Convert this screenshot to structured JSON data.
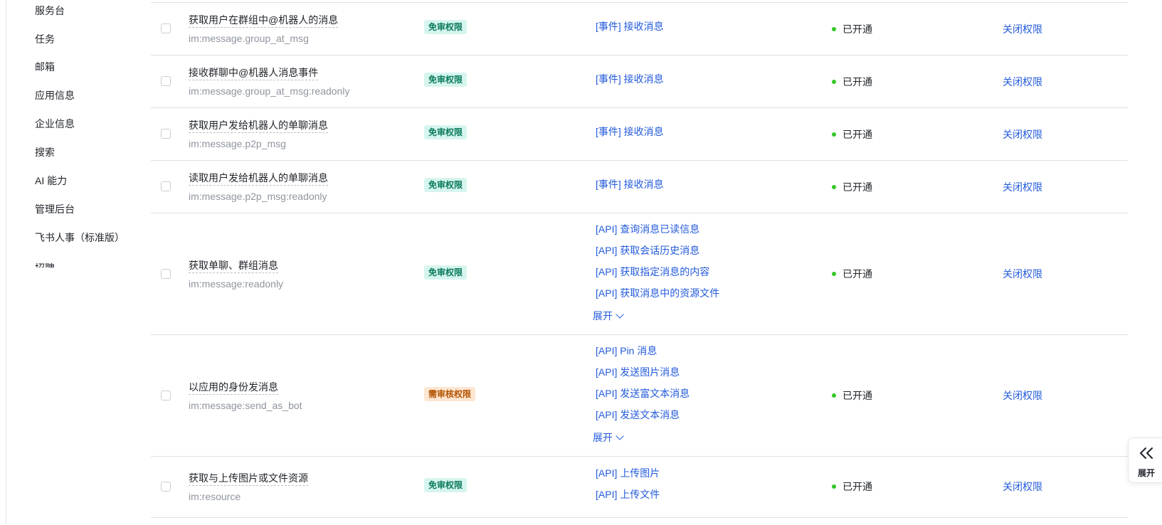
{
  "sidebar": {
    "items": [
      {
        "label": "服务台"
      },
      {
        "label": "任务"
      },
      {
        "label": "邮箱"
      },
      {
        "label": "应用信息"
      },
      {
        "label": "企业信息"
      },
      {
        "label": "搜索"
      },
      {
        "label": "AI 能力"
      },
      {
        "label": "管理后台"
      },
      {
        "label": "飞书人事（标准版）"
      },
      {
        "label": "招聘"
      }
    ]
  },
  "rows": [
    {
      "name": "获取用户在群组中@机器人的消息",
      "code": "im:message.group_at_msg",
      "tag": "免审权限",
      "apis": [
        "[事件] 接收消息"
      ],
      "expand": "",
      "status": "已开通",
      "action": "关闭权限"
    },
    {
      "name": "接收群聊中@机器人消息事件",
      "code": "im:message.group_at_msg:readonly",
      "tag": "免审权限",
      "apis": [
        "[事件] 接收消息"
      ],
      "expand": "",
      "status": "已开通",
      "action": "关闭权限"
    },
    {
      "name": "获取用户发给机器人的单聊消息",
      "code": "im:message.p2p_msg",
      "tag": "免审权限",
      "apis": [
        "[事件] 接收消息"
      ],
      "expand": "",
      "status": "已开通",
      "action": "关闭权限"
    },
    {
      "name": "读取用户发给机器人的单聊消息",
      "code": "im:message.p2p_msg:readonly",
      "tag": "免审权限",
      "apis": [
        "[事件] 接收消息"
      ],
      "expand": "",
      "status": "已开通",
      "action": "关闭权限"
    },
    {
      "name": "获取单聊、群组消息",
      "code": "im:message:readonly",
      "tag": "免审权限",
      "apis": [
        "[API] 查询消息已读信息",
        "[API] 获取会话历史消息",
        "[API] 获取指定消息的内容",
        "[API] 获取消息中的资源文件"
      ],
      "expand": "展开",
      "status": "已开通",
      "action": "关闭权限"
    },
    {
      "name": "以应用的身份发消息",
      "code": "im:message:send_as_bot",
      "tag": "需审核权限",
      "apis": [
        "[API] Pin 消息",
        "[API] 发送图片消息",
        "[API] 发送富文本消息",
        "[API] 发送文本消息"
      ],
      "expand": "展开",
      "status": "已开通",
      "action": "关闭权限"
    },
    {
      "name": "获取与上传图片或文件资源",
      "code": "im:resource",
      "tag": "免审权限",
      "apis": [
        "[API] 上传图片",
        "[API] 上传文件"
      ],
      "expand": "",
      "status": "已开通",
      "action": "关闭权限"
    }
  ],
  "float_panel": {
    "label": "展开",
    "icon": "double-chevron-left-icon"
  },
  "colors": {
    "link": "#245bdb",
    "status_ok": "#34c724",
    "free_tag_bg": "#d6f5ee",
    "review_tag_bg": "#fde6d2"
  }
}
